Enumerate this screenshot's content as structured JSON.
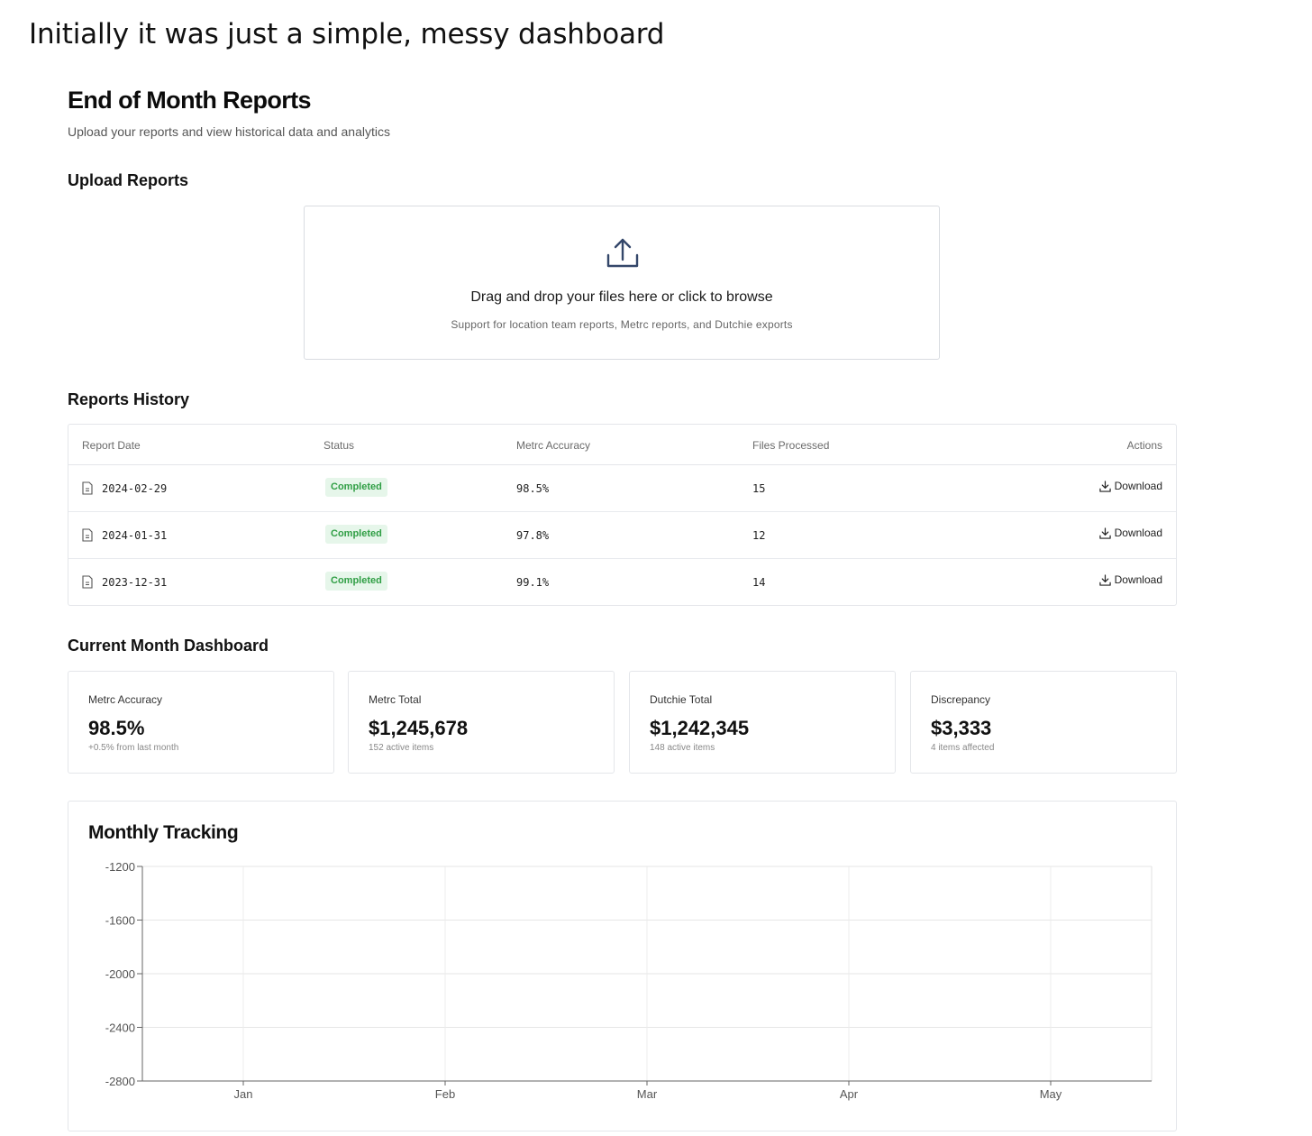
{
  "caption": "Initially it was just a simple, messy dashboard",
  "header": {
    "title": "End of Month Reports",
    "subtitle": "Upload your reports and view historical data and analytics"
  },
  "upload": {
    "section_title": "Upload Reports",
    "title": "Drag and drop your files here or click to browse",
    "subtitle": "Support for location team reports, Metrc reports, and Dutchie exports"
  },
  "history": {
    "section_title": "Reports History",
    "columns": [
      "Report Date",
      "Status",
      "Metrc Accuracy",
      "Files Processed",
      "Actions"
    ],
    "rows": [
      {
        "date": "2024-02-29",
        "status": "Completed",
        "accuracy": "98.5%",
        "files": "15",
        "action": "Download"
      },
      {
        "date": "2024-01-31",
        "status": "Completed",
        "accuracy": "97.8%",
        "files": "12",
        "action": "Download"
      },
      {
        "date": "2023-12-31",
        "status": "Completed",
        "accuracy": "99.1%",
        "files": "14",
        "action": "Download"
      }
    ]
  },
  "dashboard": {
    "section_title": "Current Month Dashboard",
    "metrics": [
      {
        "label": "Metrc Accuracy",
        "value": "98.5%",
        "sub": "+0.5% from last month"
      },
      {
        "label": "Metrc Total",
        "value": "$1,245,678",
        "sub": "152 active items"
      },
      {
        "label": "Dutchie Total",
        "value": "$1,242,345",
        "sub": "148 active items"
      },
      {
        "label": "Discrepancy",
        "value": "$3,333",
        "sub": "4 items affected"
      }
    ]
  },
  "chart_data": {
    "type": "line",
    "title": "Monthly Tracking",
    "categories": [
      "Jan",
      "Feb",
      "Mar",
      "Apr",
      "May"
    ],
    "yticks": [
      -1200,
      -1600,
      -2000,
      -2400,
      -2800
    ],
    "ylim": [
      -2800,
      -1200
    ],
    "series": [],
    "grid": true
  }
}
